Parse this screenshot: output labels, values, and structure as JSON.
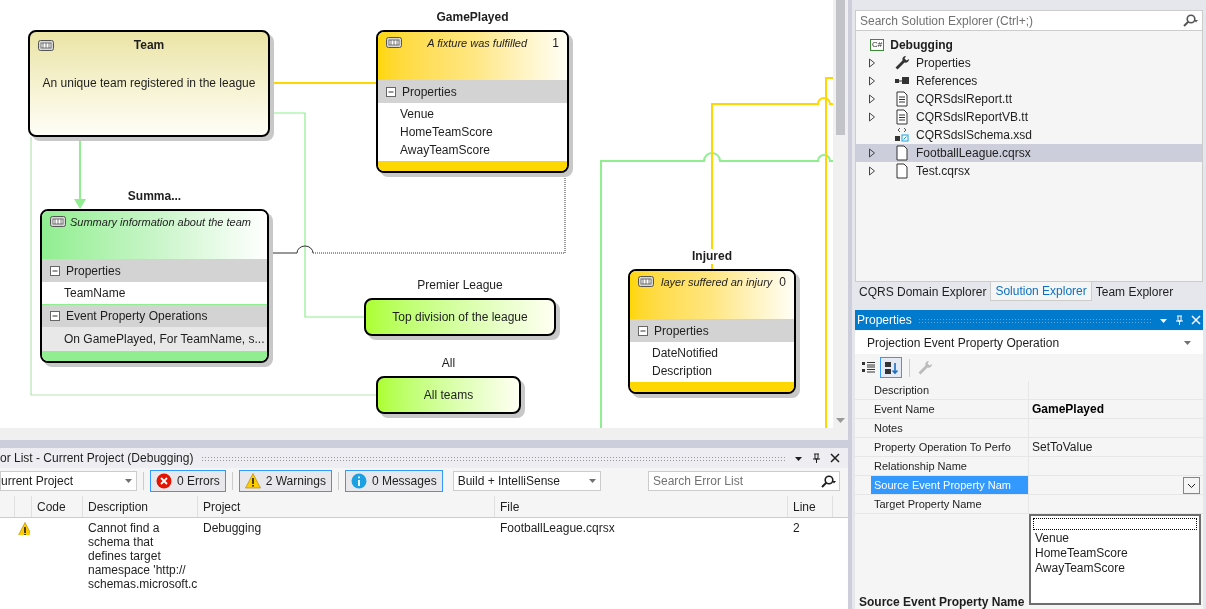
{
  "diagram": {
    "nodes": [
      {
        "kind": "aggregate",
        "title": "Team",
        "description": "An unique team registered in the league"
      },
      {
        "kind": "event",
        "label": "GamePlayed",
        "description": "A fixture was fulfilled",
        "count": "1",
        "sections": [
          {
            "title": "Properties",
            "expanded": true,
            "items": [
              "Venue",
              "HomeTeamScore",
              "AwayTeamScore"
            ]
          }
        ]
      },
      {
        "kind": "projection",
        "label": "Summa...",
        "description": "Summary information about the team",
        "sections": [
          {
            "title": "Properties",
            "expanded": true,
            "items": [
              "TeamName"
            ]
          },
          {
            "title": "Event Property Operations",
            "expanded": true,
            "items": [
              "On GamePlayed, For TeamName, s..."
            ]
          }
        ]
      },
      {
        "kind": "query",
        "label": "Premier League",
        "description": "Top division of the league"
      },
      {
        "kind": "query",
        "label": "All",
        "description": "All teams"
      },
      {
        "kind": "event",
        "label": "Injured",
        "description": "layer suffered an injury",
        "count": "0",
        "sections": [
          {
            "title": "Properties",
            "expanded": true,
            "items": [
              "DateNotified",
              "Description"
            ]
          }
        ]
      }
    ]
  },
  "error_list": {
    "title": "or List - Current Project (Debugging)",
    "scope": "urrent Project",
    "filters": [
      {
        "kind": "error",
        "label": "0 Errors",
        "selected": true
      },
      {
        "kind": "warning",
        "label": "2 Warnings",
        "selected": true
      },
      {
        "kind": "message",
        "label": "0 Messages",
        "selected": true
      }
    ],
    "source": "Build + IntelliSense",
    "search": {
      "placeholder": "Search Error List"
    },
    "columns": [
      "Code",
      "Description",
      "Project",
      "File",
      "Line"
    ],
    "rows": [
      {
        "kind": "warning",
        "description": "Cannot find a schema that defines target namespace 'http:// schemas.microsoft.c",
        "project": "Debugging",
        "file": "FootballLeague.cqrsx",
        "line": "2"
      }
    ]
  },
  "solution_explorer": {
    "search": {
      "placeholder": "Search Solution Explorer (Ctrl+;)"
    },
    "tree": [
      {
        "label": "Debugging",
        "badge": "C#",
        "kind": "project",
        "selected": false,
        "children": [
          {
            "label": "Properties",
            "kind": "wrench",
            "expanded": false,
            "selected": false
          },
          {
            "label": "References",
            "kind": "references",
            "expanded": false,
            "selected": false
          },
          {
            "label": "CQRSdslReport.tt",
            "kind": "text",
            "expanded": false,
            "selected": false
          },
          {
            "label": "CQRSdslReportVB.tt",
            "kind": "text",
            "expanded": false,
            "selected": false
          },
          {
            "label": "CQRSdslSchema.xsd",
            "kind": "schema",
            "selected": false
          },
          {
            "label": "FootballLeague.cqrsx",
            "kind": "file",
            "expanded": false,
            "selected": true
          },
          {
            "label": "Test.cqrsx",
            "kind": "file",
            "expanded": false,
            "selected": false
          }
        ]
      }
    ],
    "tabs": [
      {
        "label": "CQRS Domain Explorer",
        "selected": false
      },
      {
        "label": "Solution Explorer",
        "selected": true
      },
      {
        "label": "Team Explorer",
        "selected": false
      }
    ]
  },
  "properties": {
    "title": "Properties",
    "object": "Projection Event Property Operation",
    "rows": [
      {
        "name": "Description",
        "selected": false
      },
      {
        "name": "Event Name",
        "value": "GamePlayed",
        "modified": true,
        "selected": false
      },
      {
        "name": "Notes",
        "selected": false
      },
      {
        "name": "Property Operation To Perfo",
        "value": "SetToValue",
        "modified": false,
        "selected": false
      },
      {
        "name": "Relationship Name",
        "selected": false
      },
      {
        "name": "Source Event Property Nam",
        "selected": true
      },
      {
        "name": "Target Property Name",
        "selected": false
      }
    ],
    "dropdown_options": [
      "Venue",
      "HomeTeamScore",
      "AwayTeamScore"
    ],
    "description_title": "Source Event Property Name"
  }
}
